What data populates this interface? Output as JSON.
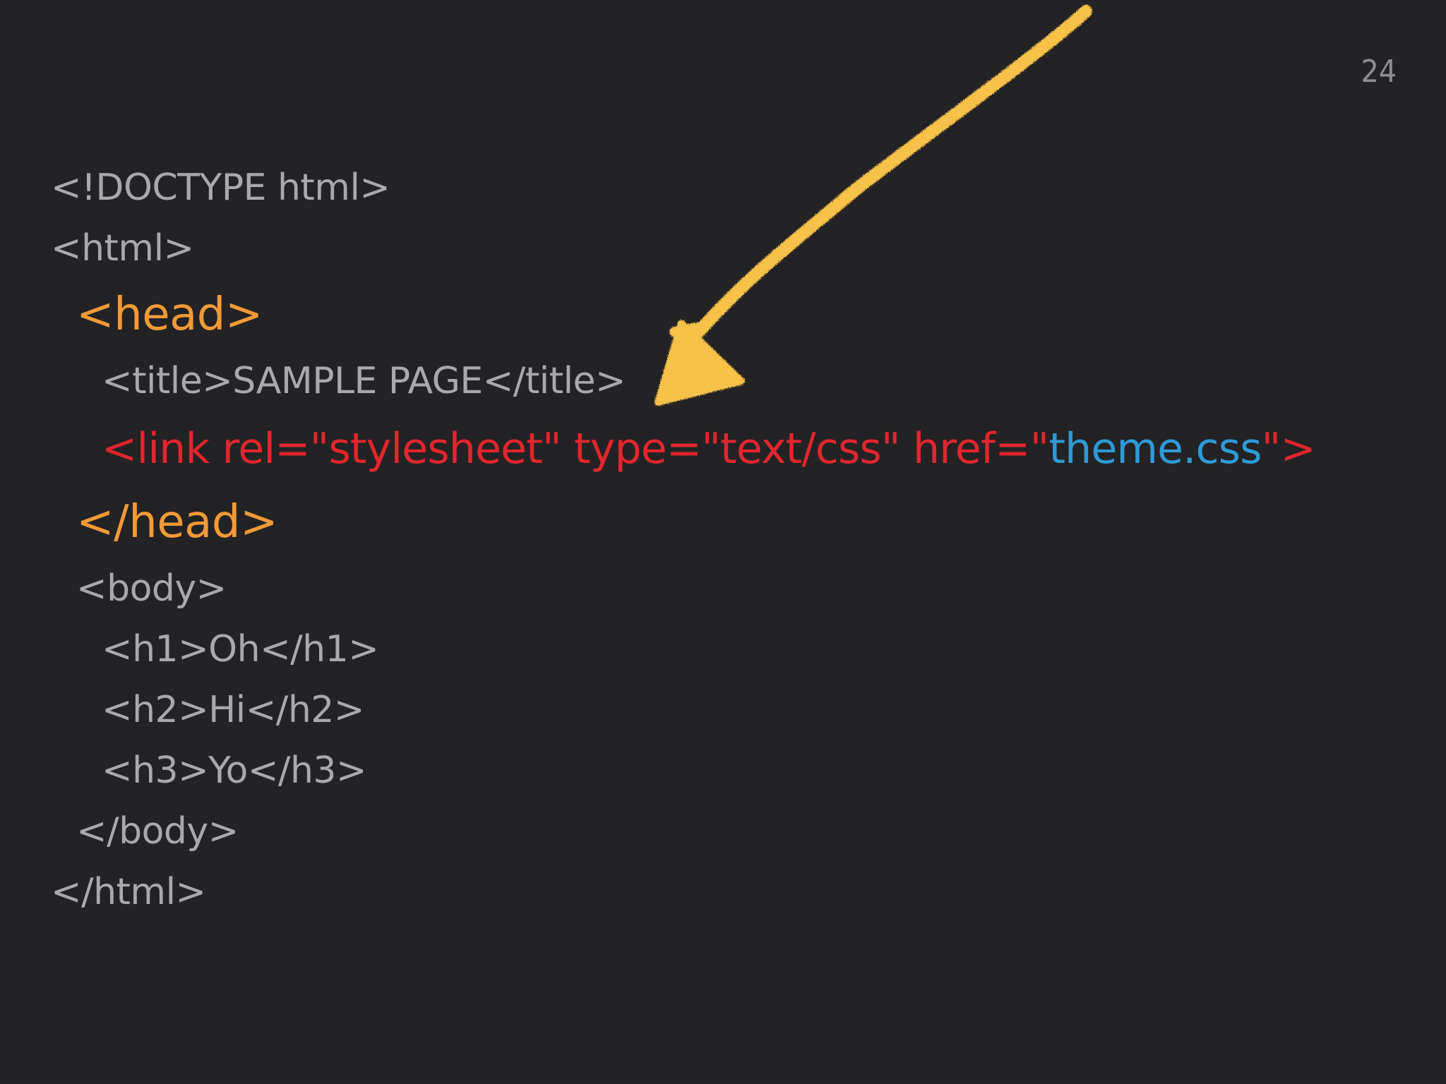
{
  "slide": {
    "page_number": "24",
    "lines": {
      "doctype": "<!DOCTYPE html>",
      "html_open": "<html>",
      "head_open": "<head>",
      "title": "<title>SAMPLE PAGE</title>",
      "link_prefix": "<link rel=\"stylesheet\" type=\"text/css\" href=\"",
      "link_href": "theme.css",
      "link_suffix": "\">",
      "head_close": "</head>",
      "body_open": "<body>",
      "h1": "<h1>Oh</h1>",
      "h2": "<h2>Hi</h2>",
      "h3": "<h3>Yo</h3>",
      "body_close": "</body>",
      "html_close": "</html>"
    },
    "colors": {
      "background": "#232224",
      "default_text": "#a9a9ab",
      "head_tag": "#f29a38",
      "link_tag": "#e0262f",
      "href_value": "#2e9ad6",
      "arrow": "#f7c24a"
    },
    "annotation": {
      "icon": "hand-drawn-arrow-icon"
    }
  }
}
